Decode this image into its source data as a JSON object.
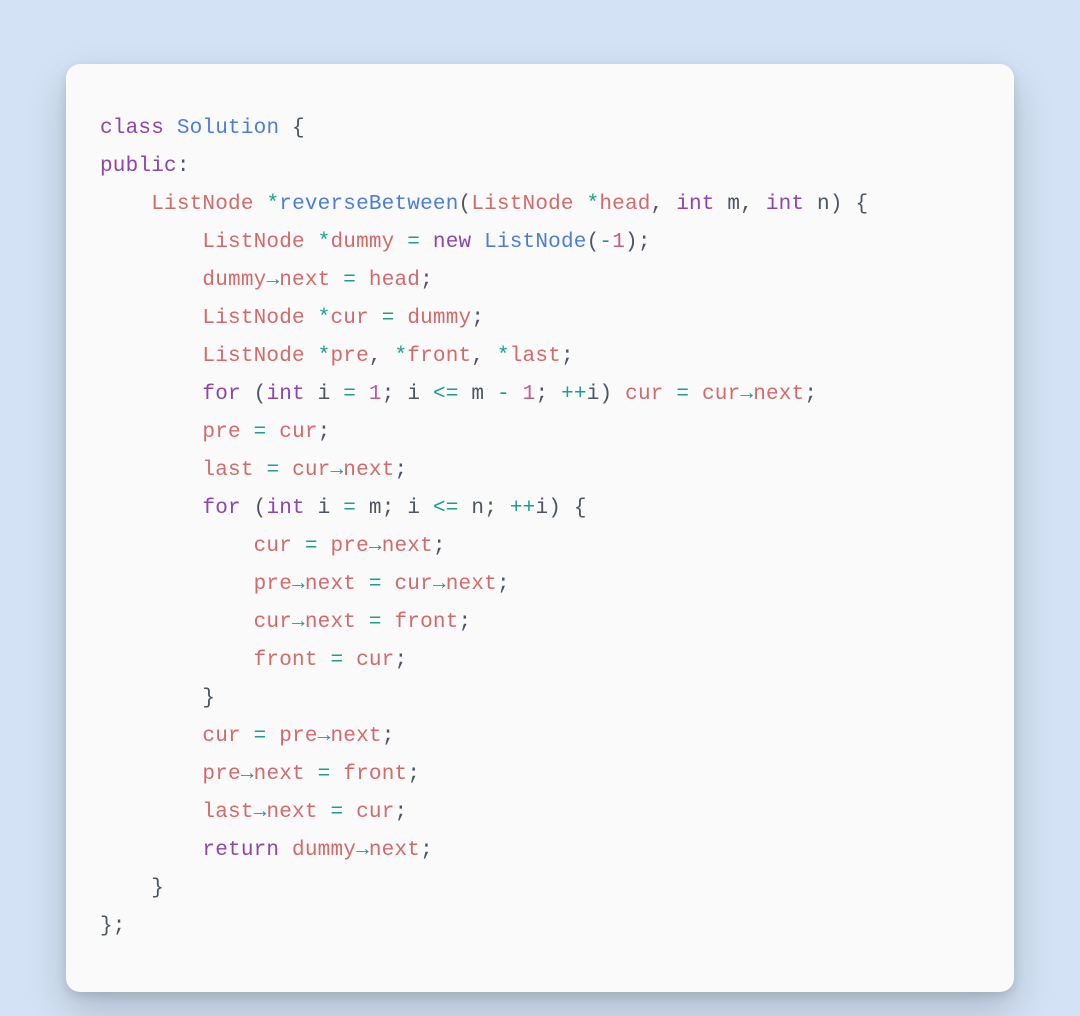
{
  "code": {
    "kw_class": "class",
    "class_name": "Solution",
    "brace_open": " {",
    "kw_public": "public",
    "colon": ":",
    "indent1": "    ",
    "indent2": "        ",
    "indent3": "            ",
    "ret_type": "ListNode",
    "star": "*",
    "fn_name": "reverseBetween",
    "lparen": "(",
    "rparen": ")",
    "param0_type": "ListNode",
    "param0_name": "head",
    "comma_sp": ", ",
    "int_kw": "int",
    "param1_name": "m",
    "param2_name": "n",
    "space": " ",
    "type_ListNode": "ListNode",
    "var_dummy": "dummy",
    "eq": "=",
    "kw_new": "new",
    "minus_one": "-1",
    "neg": "-",
    "one": "1",
    "semi": ";",
    "arrow": "→",
    "member_next": "next",
    "var_head": "head",
    "var_cur": "cur",
    "var_pre": "pre",
    "var_front": "front",
    "var_last": "last",
    "kw_for": "for",
    "var_i": "i",
    "le": "<=",
    "minus": "-",
    "preinc": "++",
    "kw_return": "return",
    "brace_close": "}",
    "l3_text_open": " {",
    "close_brace_semi": "};"
  },
  "language": "C++"
}
